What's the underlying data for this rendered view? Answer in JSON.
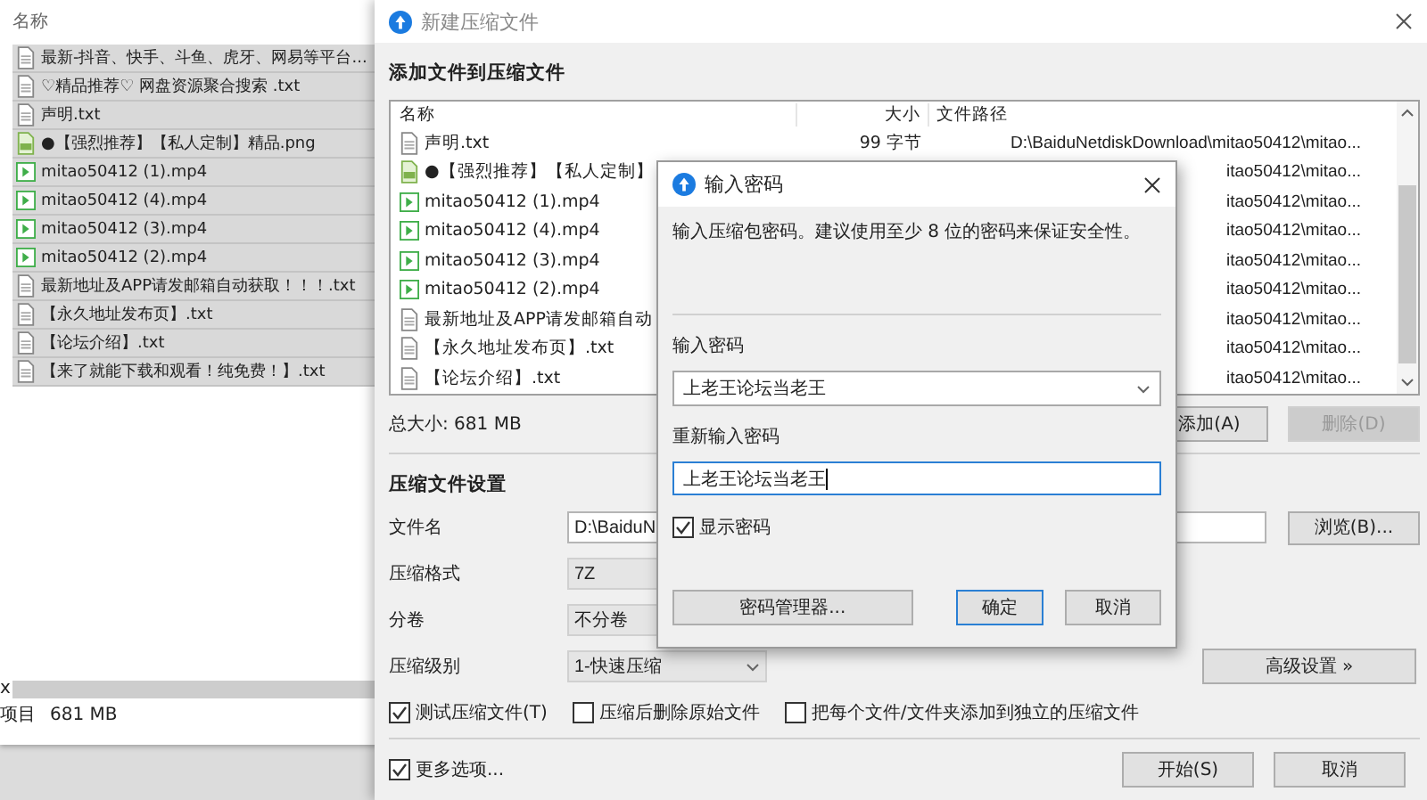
{
  "explorer": {
    "header": "名称",
    "files": [
      {
        "name": "最新-抖音、快手、斗鱼、虎牙、网易等平台...",
        "kind": "document",
        "selected": true
      },
      {
        "name": "♡精品推荐♡ 网盘资源聚合搜索 .txt",
        "kind": "document",
        "selected": true
      },
      {
        "name": "声明.txt",
        "kind": "document",
        "selected": true
      },
      {
        "name": "●【强烈推荐】【私人定制】精品.png",
        "kind": "image",
        "selected": true
      },
      {
        "name": "mitao50412 (1).mp4",
        "kind": "video",
        "selected": true
      },
      {
        "name": "mitao50412 (4).mp4",
        "kind": "video",
        "selected": true
      },
      {
        "name": "mitao50412 (3).mp4",
        "kind": "video",
        "selected": true
      },
      {
        "name": "mitao50412 (2).mp4",
        "kind": "video",
        "selected": true
      },
      {
        "name": "最新地址及APP请发邮箱自动获取！！！.txt",
        "kind": "document",
        "selected": true
      },
      {
        "name": "【永久地址发布页】.txt",
        "kind": "document",
        "selected": true
      },
      {
        "name": "【论坛介绍】.txt",
        "kind": "document",
        "selected": true
      },
      {
        "name": "【来了就能下载和观看！纯免费！】.txt",
        "kind": "document",
        "selected": true
      }
    ],
    "scroll_text": "x",
    "status_count": "项目",
    "status_size": "681 MB"
  },
  "main": {
    "title": "新建压缩文件",
    "section": "添加文件到压缩文件",
    "columns": [
      "名称",
      "大小",
      "文件路径"
    ],
    "rows": [
      {
        "name": "声明.txt",
        "kind": "document",
        "size": "99 字节",
        "path": "D:\\BaiduNetdiskDownload\\mitao50412\\mitao..."
      },
      {
        "name": "●【强烈推荐】【私人定制】",
        "kind": "image",
        "path": "itao50412\\mitao..."
      },
      {
        "name": "mitao50412 (1).mp4",
        "kind": "video",
        "path": "itao50412\\mitao..."
      },
      {
        "name": "mitao50412 (4).mp4",
        "kind": "video",
        "path": "itao50412\\mitao..."
      },
      {
        "name": "mitao50412 (3).mp4",
        "kind": "video",
        "path": "itao50412\\mitao..."
      },
      {
        "name": "mitao50412 (2).mp4",
        "kind": "video",
        "path": "itao50412\\mitao..."
      },
      {
        "name": "最新地址及APP请发邮箱自动",
        "kind": "document",
        "path": "itao50412\\mitao..."
      },
      {
        "name": "【永久地址发布页】.txt",
        "kind": "document",
        "path": "itao50412\\mitao..."
      },
      {
        "name": "【论坛介绍】.txt",
        "kind": "document",
        "path": "itao50412\\mitao..."
      }
    ],
    "total": "总大小: 681 MB",
    "add_button": {
      "label": "添加(A)",
      "disabled": false
    },
    "delete_button": {
      "label": "删除(D)",
      "disabled": true
    },
    "settings_heading": "压缩文件设置",
    "filename": {
      "label": "文件名",
      "value": "D:\\BaiduN"
    },
    "browse_button": "浏览(B)...",
    "format": {
      "label": "压缩格式",
      "value": "7Z"
    },
    "split": {
      "label": "分卷",
      "value": "不分卷"
    },
    "level": {
      "label": "压缩级别",
      "value": "1-快速压缩"
    },
    "advanced_button": "高级设置 »",
    "options": [
      {
        "label": "测试压缩文件(T)",
        "checked": true
      },
      {
        "label": "压缩后删除原始文件",
        "checked": false
      },
      {
        "label": "把每个文件/文件夹添加到独立的压缩文件",
        "checked": false
      }
    ],
    "more_options": {
      "label": "更多选项...",
      "checked": true
    },
    "start_button": "开始(S)",
    "cancel_button": "取消"
  },
  "password_dialog": {
    "title": "输入密码",
    "message": "输入压缩包密码。建议使用至少 8 位的密码来保证安全性。",
    "password_label": "输入密码",
    "password_value": "上老王论坛当老王",
    "reenter_label": "重新输入密码",
    "reenter_value": "上老王论坛当老王",
    "show_password": {
      "label": "显示密码",
      "checked": true
    },
    "manager_button": "密码管理器...",
    "ok_button": "确定",
    "cancel_button": "取消"
  }
}
